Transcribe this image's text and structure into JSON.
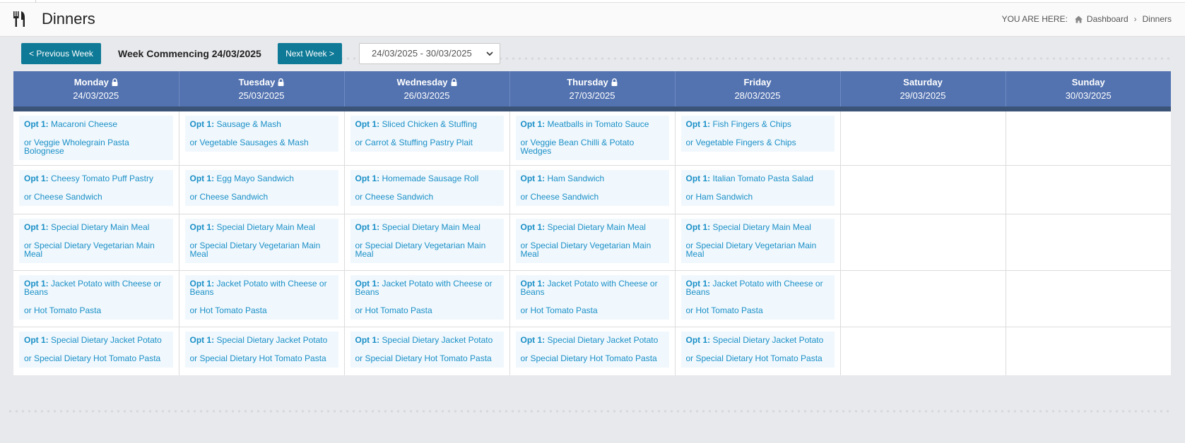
{
  "header": {
    "title": "Dinners",
    "page_icon": "cutlery-icon",
    "breadcrumb": {
      "you_are_here": "YOU ARE HERE:",
      "items": [
        "Dashboard",
        "Dinners"
      ]
    }
  },
  "toolbar": {
    "prev_label": "< Previous Week",
    "week_label": "Week Commencing 24/03/2025",
    "next_label": "Next Week >",
    "week_select_value": "24/03/2025 - 30/03/2025"
  },
  "days": [
    {
      "name": "Monday",
      "date": "24/03/2025",
      "locked": true
    },
    {
      "name": "Tuesday",
      "date": "25/03/2025",
      "locked": true
    },
    {
      "name": "Wednesday",
      "date": "26/03/2025",
      "locked": true
    },
    {
      "name": "Thursday",
      "date": "27/03/2025",
      "locked": true
    },
    {
      "name": "Friday",
      "date": "28/03/2025",
      "locked": false
    },
    {
      "name": "Saturday",
      "date": "29/03/2025",
      "locked": false
    },
    {
      "name": "Sunday",
      "date": "30/03/2025",
      "locked": false
    }
  ],
  "opt_prefix": "Opt 1:",
  "rows": [
    [
      {
        "opt1": "Macaroni Cheese",
        "alt": "or Veggie Wholegrain Pasta Bolognese"
      },
      {
        "opt1": "Sausage & Mash",
        "alt": "or Vegetable Sausages & Mash"
      },
      {
        "opt1": "Sliced Chicken & Stuffing",
        "alt": "or Carrot & Stuffing Pastry Plait"
      },
      {
        "opt1": "Meatballs in Tomato Sauce",
        "alt": "or Veggie Bean Chilli & Potato Wedges"
      },
      {
        "opt1": "Fish Fingers & Chips",
        "alt": "or Vegetable Fingers & Chips"
      }
    ],
    [
      {
        "opt1": "Cheesy Tomato Puff Pastry",
        "alt": "or Cheese Sandwich"
      },
      {
        "opt1": "Egg Mayo Sandwich",
        "alt": "or Cheese Sandwich"
      },
      {
        "opt1": "Homemade Sausage Roll",
        "alt": "or Cheese Sandwich"
      },
      {
        "opt1": "Ham Sandwich",
        "alt": "or Cheese Sandwich"
      },
      {
        "opt1": "Italian Tomato Pasta Salad",
        "alt": "or Ham Sandwich"
      }
    ],
    [
      {
        "opt1": "Special Dietary Main Meal",
        "alt": "or Special Dietary Vegetarian Main Meal"
      },
      {
        "opt1": "Special Dietary Main Meal",
        "alt": "or Special Dietary Vegetarian Main Meal"
      },
      {
        "opt1": "Special Dietary Main Meal",
        "alt": "or Special Dietary Vegetarian Main Meal"
      },
      {
        "opt1": "Special Dietary Main Meal",
        "alt": "or Special Dietary Vegetarian Main Meal"
      },
      {
        "opt1": "Special Dietary Main Meal",
        "alt": "or Special Dietary Vegetarian Main Meal"
      }
    ],
    [
      {
        "opt1": "Jacket Potato with Cheese or Beans",
        "alt": "or Hot Tomato Pasta"
      },
      {
        "opt1": "Jacket Potato with Cheese or Beans",
        "alt": "or Hot Tomato Pasta"
      },
      {
        "opt1": "Jacket Potato with Cheese or Beans",
        "alt": "or Hot Tomato Pasta"
      },
      {
        "opt1": "Jacket Potato with Cheese or Beans",
        "alt": "or Hot Tomato Pasta"
      },
      {
        "opt1": "Jacket Potato with Cheese or Beans",
        "alt": "or Hot Tomato Pasta"
      }
    ],
    [
      {
        "opt1": "Special Dietary Jacket Potato",
        "alt": "or Special Dietary Hot Tomato Pasta"
      },
      {
        "opt1": "Special Dietary Jacket Potato",
        "alt": "or Special Dietary Hot Tomato Pasta"
      },
      {
        "opt1": "Special Dietary Jacket Potato",
        "alt": "or Special Dietary Hot Tomato Pasta"
      },
      {
        "opt1": "Special Dietary Jacket Potato",
        "alt": "or Special Dietary Hot Tomato Pasta"
      },
      {
        "opt1": "Special Dietary Jacket Potato",
        "alt": "or Special Dietary Hot Tomato Pasta"
      }
    ]
  ],
  "colors": {
    "header_blue": "#5272b0",
    "button_teal": "#0e7a97",
    "link_blue": "#1a8fc7",
    "meal_bg": "#f1f8fd"
  }
}
